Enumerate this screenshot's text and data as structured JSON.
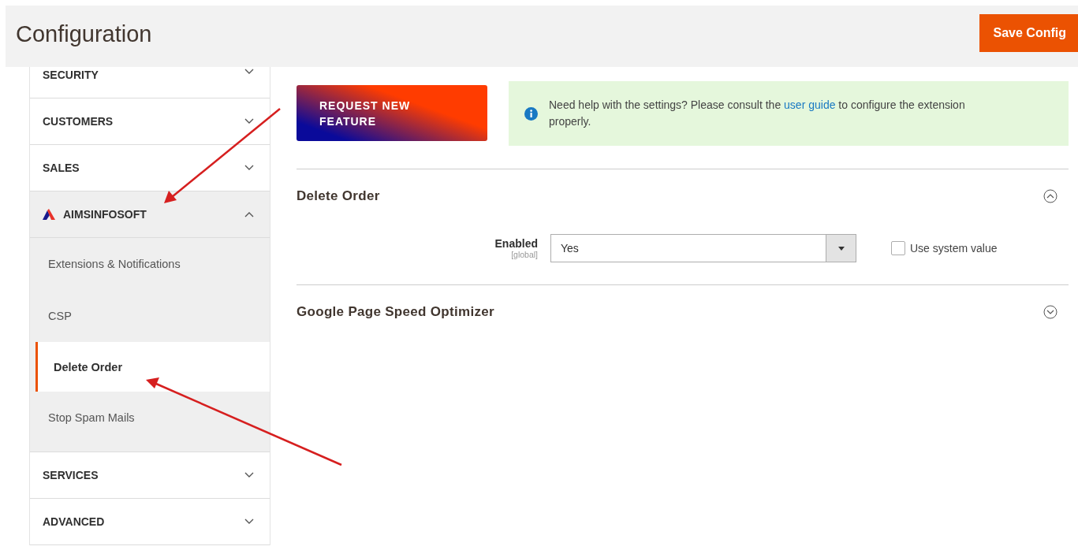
{
  "header": {
    "title": "Configuration",
    "save_button": "Save Config"
  },
  "sidebar": {
    "sections": [
      {
        "label": "SECURITY",
        "expanded": false,
        "logo": false
      },
      {
        "label": "CUSTOMERS",
        "expanded": false,
        "logo": false
      },
      {
        "label": "SALES",
        "expanded": false,
        "logo": false
      },
      {
        "label": "AIMSINFOSOFT",
        "expanded": true,
        "logo": true,
        "children": [
          {
            "label": "Extensions & Notifications",
            "selected": false
          },
          {
            "label": "CSP",
            "selected": false
          },
          {
            "label": "Delete Order",
            "selected": true
          },
          {
            "label": "Stop Spam Mails",
            "selected": false
          }
        ]
      },
      {
        "label": "SERVICES",
        "expanded": false,
        "logo": false
      },
      {
        "label": "ADVANCED",
        "expanded": false,
        "logo": false
      }
    ]
  },
  "request_button": "REQUEST NEW FEATURE",
  "notice": {
    "before": "Need help with the settings? Please consult the",
    "link": "user guide",
    "after": "to configure the extension properly."
  },
  "groups": [
    {
      "title": "Delete Order",
      "expanded": true,
      "fields": [
        {
          "label": "Enabled",
          "scope": "[global]",
          "value": "Yes",
          "use_system_value": {
            "label": "Use system value",
            "checked": false
          }
        }
      ]
    },
    {
      "title": "Google Page Speed Optimizer",
      "expanded": false
    }
  ]
}
